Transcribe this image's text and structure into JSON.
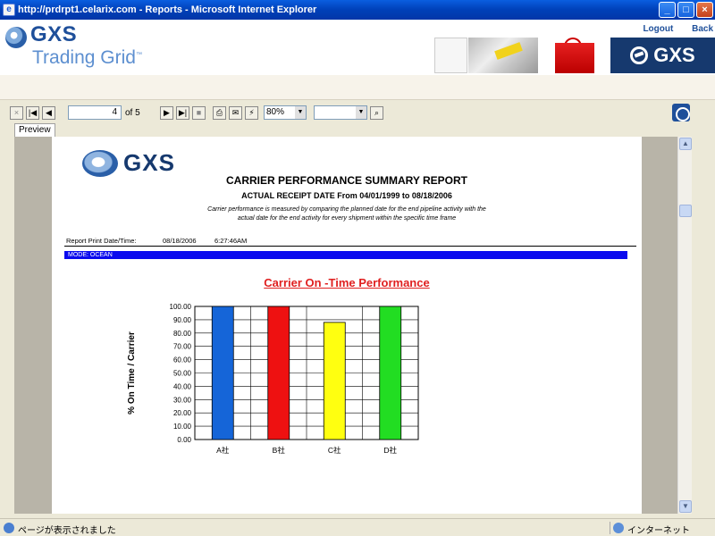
{
  "window": {
    "title": "http://prdrpt1.celarix.com - Reports - Microsoft Internet Explorer",
    "minimize_label": "_",
    "maximize_label": "□",
    "close_label": "×"
  },
  "header": {
    "brand_line1": "GXS",
    "brand_line2": "Trading Grid",
    "brand_tm": "™",
    "right_brand": "GXS",
    "logout": "Logout",
    "back": "Back"
  },
  "toolbar": {
    "close_icon": "×",
    "first_icon": "|◀",
    "prev_icon": "◀",
    "page_value": "4",
    "page_of": "of 5",
    "next_icon": "▶",
    "last_icon": "▶|",
    "stop_icon": "■",
    "print_icon": "⎙",
    "export_icon": "✉",
    "refresh_icon": "⚡",
    "zoom_value": "80%",
    "search_value": "",
    "find_icon": "⌕",
    "dropdown_arrow": "▼"
  },
  "tabs": {
    "preview": "Preview"
  },
  "report": {
    "logo_text": "GXS",
    "title": "CARRIER PERFORMANCE SUMMARY REPORT",
    "subtitle": "ACTUAL RECEIPT DATE  From 04/01/1999 to 08/18/2006",
    "desc_line1": "Carrier performance is measured by comparing the planned date for the end pipeline activity with the",
    "desc_line2": "actual date for the end activity for every shipment within the specific time frame",
    "print_label": "Report Print Date/Time:",
    "print_date": "08/18/2006",
    "print_time": "6:27:46AM",
    "mode": "MODE: OCEAN"
  },
  "chart_data": {
    "type": "bar",
    "title": "Carrier On -Time Performance",
    "xlabel": "",
    "ylabel": "% On Time / Carrier",
    "categories": [
      "A社",
      "B社",
      "C社",
      "D社"
    ],
    "values": [
      100,
      100,
      88,
      100
    ],
    "bar_colors": [
      "#1565d8",
      "#ee1111",
      "#ffff10",
      "#22dd22"
    ],
    "ylim": [
      0,
      100
    ],
    "yticks": [
      "0.00",
      "10.00",
      "20.00",
      "30.00",
      "40.00",
      "50.00",
      "60.00",
      "70.00",
      "80.00",
      "90.00",
      "100.00"
    ],
    "grid": true,
    "legend": "none"
  },
  "status": {
    "left": "ページが表示されました",
    "right": "インターネット"
  }
}
